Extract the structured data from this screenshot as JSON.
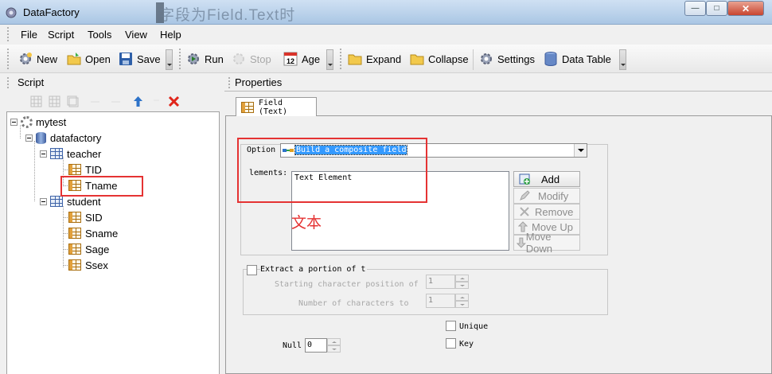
{
  "window": {
    "title": "DataFactory",
    "overlay_text": "字段为Field.Text时"
  },
  "menu": {
    "items": [
      {
        "label": "File",
        "key": "F"
      },
      {
        "label": "Script",
        "key": "S"
      },
      {
        "label": "Tools",
        "key": "T"
      },
      {
        "label": "View",
        "key": "V"
      },
      {
        "label": "Help",
        "key": "H"
      }
    ]
  },
  "toolbar": {
    "new": "New",
    "open": "Open",
    "save": "Save",
    "run": "Run",
    "stop": "Stop",
    "age": "Age",
    "age_icon_text": "12",
    "expand": "Expand",
    "collapse": "Collapse",
    "settings": "Settings",
    "data_table": "Data Table"
  },
  "script_panel": {
    "title": "Script",
    "tree": {
      "root": "mytest",
      "database": "datafactory",
      "tables": [
        {
          "name": "teacher",
          "fields": [
            "TID",
            "Tname"
          ]
        },
        {
          "name": "student",
          "fields": [
            "SID",
            "Sname",
            "Sage",
            "Ssex"
          ]
        }
      ]
    }
  },
  "properties_panel": {
    "title": "Properties",
    "tab_label": "Field (Text)",
    "option": {
      "label": "Option",
      "value": "Build a composite field"
    },
    "elements": {
      "label": "lements:",
      "items": [
        "Text Element"
      ]
    },
    "annotation": "文本",
    "buttons": {
      "add": "Add",
      "modify": "Modify",
      "remove": "Remove",
      "move_up": "Move Up",
      "move_down": "Move Down"
    },
    "extract": {
      "label": "Extract a portion of t",
      "start_label": "Starting character position of",
      "start_value": "1",
      "count_label": "Number of characters to",
      "count_value": "1"
    },
    "unique_label": "Unique",
    "key_label": "Key",
    "null_label": "Null",
    "null_value": "0"
  },
  "colors": {
    "highlight_red": "#e53333",
    "selection_blue": "#3399ff"
  }
}
